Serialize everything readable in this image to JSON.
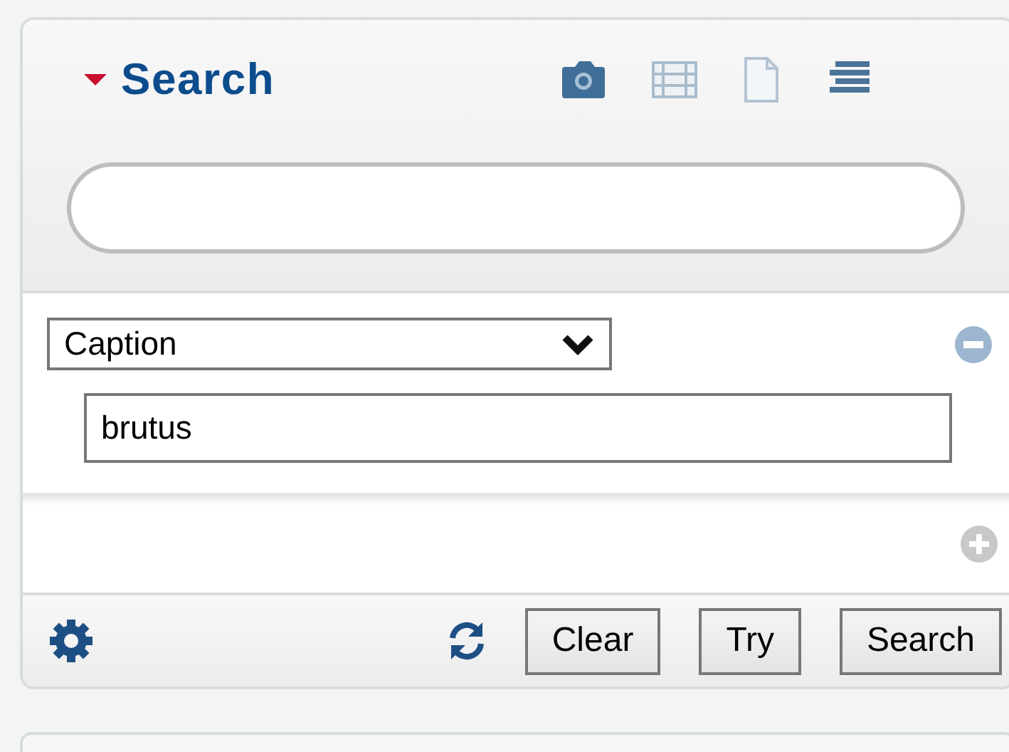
{
  "panel": {
    "title": "Search",
    "expanded": true
  },
  "criteria": [
    {
      "field": "Caption",
      "value": "brutus"
    }
  ],
  "buttons": [
    {
      "label": "Clear"
    },
    {
      "label": "Try"
    },
    {
      "label": "Search"
    }
  ]
}
